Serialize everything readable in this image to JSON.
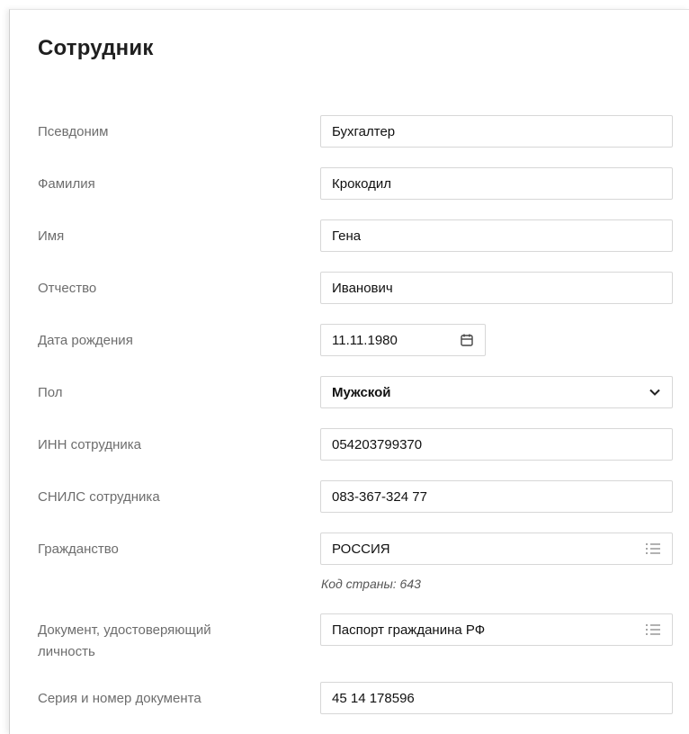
{
  "page": {
    "title": "Сотрудник"
  },
  "fields": {
    "alias": {
      "label": "Псевдоним",
      "value": "Бухгалтер"
    },
    "last_name": {
      "label": "Фамилия",
      "value": "Крокодил"
    },
    "first_name": {
      "label": "Имя",
      "value": "Гена"
    },
    "patronymic": {
      "label": "Отчество",
      "value": "Иванович"
    },
    "birth_date": {
      "label": "Дата рождения",
      "value": "11.11.1980",
      "icon": "calendar-icon"
    },
    "gender": {
      "label": "Пол",
      "value": "Мужской",
      "icon": "chevron-down-icon"
    },
    "inn": {
      "label": "ИНН сотрудника",
      "value": "054203799370"
    },
    "snils": {
      "label": "СНИЛС сотрудника",
      "value": "083-367-324 77"
    },
    "citizenship": {
      "label": "Гражданство",
      "value": "РОССИЯ",
      "icon": "list-icon",
      "hint": "Код страны: 643"
    },
    "id_document": {
      "label_line1": "Документ, удостоверяющий",
      "label_line2": "личность",
      "value": "Паспорт гражданина РФ",
      "icon": "list-icon"
    },
    "doc_number": {
      "label": "Серия и номер документа",
      "value": "45 14 178596"
    }
  }
}
